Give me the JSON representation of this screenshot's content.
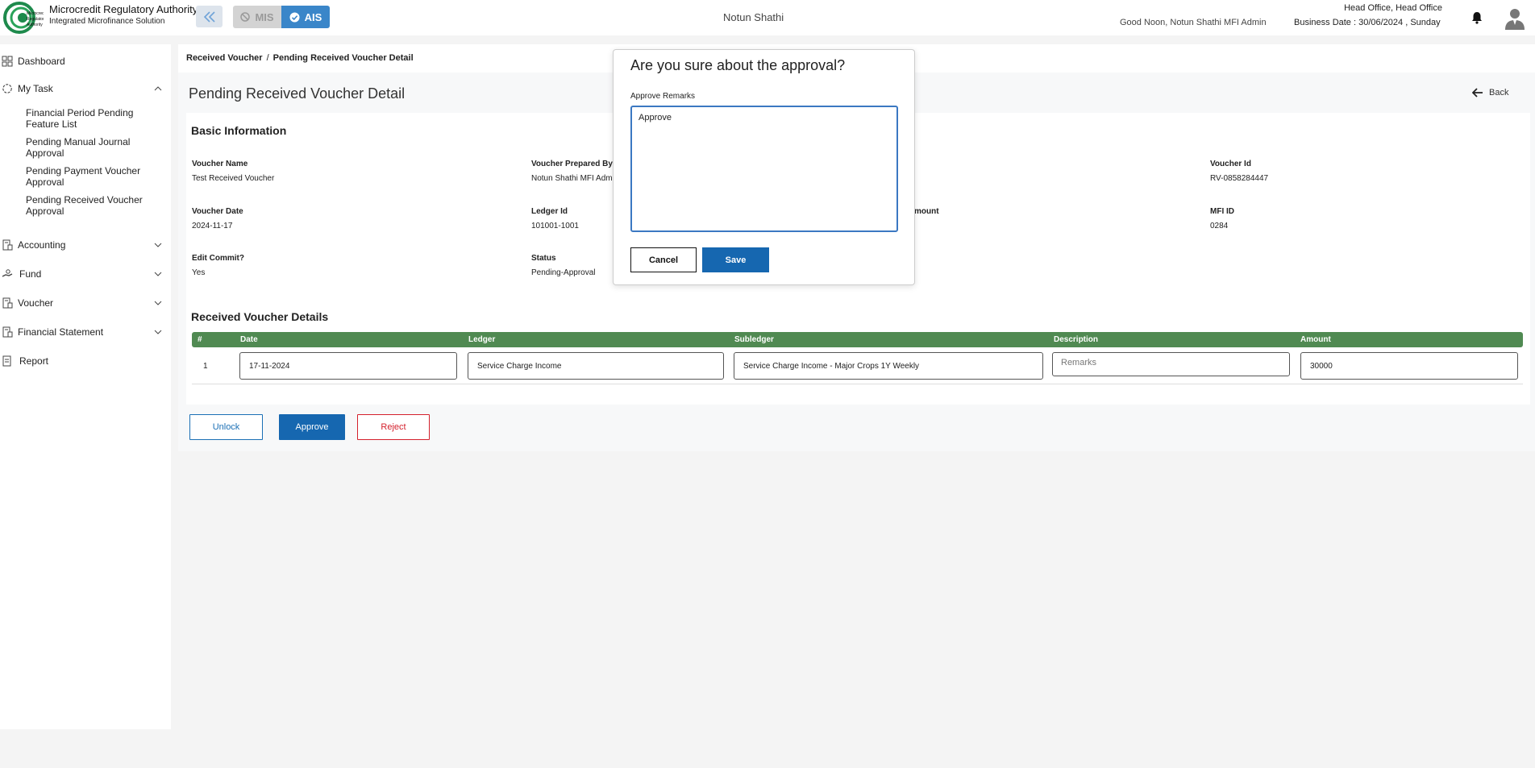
{
  "header": {
    "brand_title": "Microcredit Regulatory Authority",
    "brand_subtitle": "Integrated Microfinance Solution",
    "logo_text": "Microcredit Regulatory Authority",
    "mis_label": "MIS",
    "ais_label": "AIS",
    "org_name": "Notun Shathi",
    "greeting": "Good Noon, Notun Shathi MFI Admin",
    "office": "Head Office, Head Office",
    "business_date": "Business Date : 30/06/2024 , Sunday"
  },
  "sidebar": {
    "dashboard": "Dashboard",
    "my_task": "My Task",
    "sub_items": [
      "Financial Period Pending Feature List",
      "Pending Manual Journal Approval",
      "Pending Payment Voucher Approval",
      "Pending Received Voucher Approval"
    ],
    "accounting": "Accounting",
    "fund": "Fund",
    "voucher": "Voucher",
    "financial_statement": "Financial Statement",
    "report": "Report"
  },
  "breadcrumb": {
    "parent": "Received Voucher",
    "separator": "/",
    "current": "Pending Received Voucher Detail"
  },
  "page": {
    "title": "Pending Received Voucher Detail",
    "back_label": "Back"
  },
  "basic_info": {
    "title": "Basic Information",
    "voucher_name_label": "Voucher Name",
    "voucher_name": "Test Received Voucher",
    "prepared_by_label": "Voucher Prepared By",
    "prepared_by": "Notun Shathi MFI Adm",
    "voucher_id_label": "Voucher Id",
    "voucher_id": "RV-0858284447",
    "voucher_date_label": "Voucher Date",
    "voucher_date": "2024-11-17",
    "ledger_id_label": "Ledger Id",
    "ledger_id": "101001-1001",
    "amount_label_partial": "mount",
    "mfi_id_label": "MFI ID",
    "mfi_id": "0284",
    "edit_commit_label": "Edit Commit?",
    "edit_commit": "Yes",
    "status_label": "Status",
    "status": "Pending-Approval"
  },
  "details": {
    "title": "Received Voucher Details",
    "columns": [
      "#",
      "Date",
      "Ledger",
      "Subledger",
      "Description",
      "Amount"
    ],
    "rows": [
      {
        "index": "1",
        "date": "17-11-2024",
        "ledger": "Service Charge Income",
        "subledger": "Service Charge Income - Major Crops 1Y Weekly",
        "description_placeholder": "Remarks",
        "amount": "30000"
      }
    ]
  },
  "actions": {
    "unlock": "Unlock",
    "approve": "Approve",
    "reject": "Reject"
  },
  "modal": {
    "title": "Are you sure about the approval?",
    "remarks_label": "Approve Remarks",
    "remarks_value": "Approve",
    "cancel": "Cancel",
    "save": "Save"
  },
  "colors": {
    "table_header": "#508a52",
    "primary": "#1667b0",
    "danger": "#d4202c"
  }
}
